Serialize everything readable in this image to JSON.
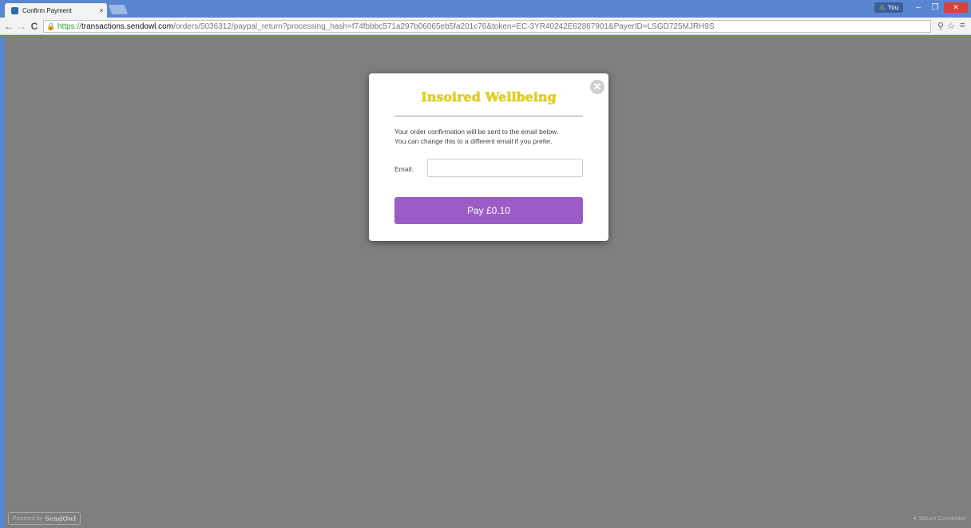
{
  "browser": {
    "tab_title": "Confirm Payment",
    "tab_close": "×",
    "profile_name": "You",
    "profile_warning": "⚠",
    "window_minimize": "–",
    "window_maximize": "❐",
    "window_close": "✕",
    "nav_back": "←",
    "nav_forward": "→",
    "nav_reload": "C",
    "url_scheme": "https://",
    "url_host": "transactions.sendowl.com",
    "url_path": "/orders/5036312/paypal_return?processing_hash=f74fbbbc571a297b06065eb5fa201c76&token=EC-3YR40242E62867901&PayerID=LSGD725MJRH9S",
    "lock_icon": "🔒",
    "key_icon": "⚲",
    "star_icon": "☆",
    "menu_icon": "≡"
  },
  "modal": {
    "close_icon": "✕",
    "brand": "Insoired Wellbeing",
    "info_line1": "Your order confirmation will be sent to the email below.",
    "info_line2": "You can change this to a different email if you prefer.",
    "email_label": "Email:",
    "email_value": "",
    "pay_label": "Pay £0.10"
  },
  "footer": {
    "powered_prefix": "Powered by",
    "powered_brand": "SendOwl",
    "secure_text": "Secure Connection"
  },
  "colors": {
    "overlay": "#7f7f7f",
    "pay_button": "#9b5dc5",
    "brand_text": "#e6d400"
  }
}
